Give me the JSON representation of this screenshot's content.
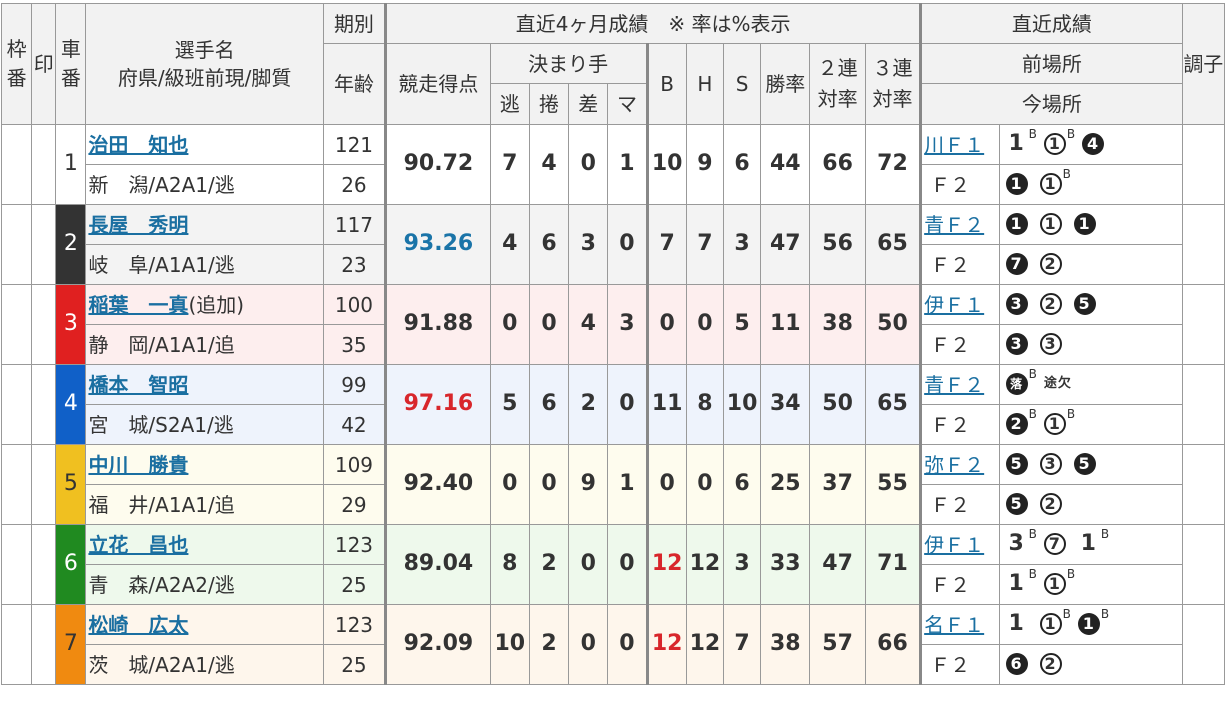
{
  "header": {
    "waku": "枠番",
    "shirushi": "印",
    "sha": "車番",
    "senshu": "選手名",
    "senshu_sub": "府県/級班前現/脚質",
    "kibetsu": "期別",
    "nenrei": "年齢",
    "recent4": "直近4ヶ月成績　※ 率は%表示",
    "score": "競走得点",
    "kimarite": "決まり手",
    "nige": "逃",
    "makuri": "捲",
    "sashi": "差",
    "ma": "マ",
    "b": "B",
    "h": "H",
    "s": "S",
    "win": "勝率",
    "ren2": "２連対率",
    "ren3": "３連対率",
    "recent": "直近成績",
    "prev": "前場所",
    "now": "今場所",
    "choshi": "調子"
  },
  "riders": [
    {
      "num": "1",
      "name": "治田　知也",
      "suffix": "",
      "pref": "新　潟/A2A1/逃",
      "term": "121",
      "age": "26",
      "score": "90.72",
      "score_color": "",
      "nige": "7",
      "makuri": "4",
      "sashi": "0",
      "ma": "1",
      "b": "10",
      "b_color": "",
      "h": "9",
      "s": "6",
      "win": "44",
      "ren2": "66",
      "ren3": "72",
      "venue": "川Ｆ１",
      "venue2": "Ｆ２",
      "bg": "#ffffff",
      "num_bg": "#ffffff",
      "num_fg": "#333333"
    },
    {
      "num": "2",
      "name": "長屋　秀明",
      "suffix": "",
      "pref": "岐　阜/A1A1/逃",
      "term": "117",
      "age": "23",
      "score": "93.26",
      "score_color": "blue",
      "nige": "4",
      "makuri": "6",
      "sashi": "3",
      "ma": "0",
      "b": "7",
      "b_color": "",
      "h": "7",
      "s": "3",
      "win": "47",
      "ren2": "56",
      "ren3": "65",
      "venue": "青Ｆ２",
      "venue2": "Ｆ２",
      "bg": "#f3f3f3",
      "num_bg": "#333333",
      "num_fg": "#ffffff"
    },
    {
      "num": "3",
      "name": "稲葉　一真",
      "suffix": "(追加)",
      "pref": "静　岡/A1A1/追",
      "term": "100",
      "age": "35",
      "score": "91.88",
      "score_color": "",
      "nige": "0",
      "makuri": "0",
      "sashi": "4",
      "ma": "3",
      "b": "0",
      "b_color": "",
      "h": "0",
      "s": "5",
      "win": "11",
      "ren2": "38",
      "ren3": "50",
      "venue": "伊Ｆ１",
      "venue2": "Ｆ２",
      "bg": "#fdeeee",
      "num_bg": "#e02020",
      "num_fg": "#ffffff"
    },
    {
      "num": "4",
      "name": "橋本　智昭",
      "suffix": "",
      "pref": "宮　城/S2A1/逃",
      "term": "99",
      "age": "42",
      "score": "97.16",
      "score_color": "red",
      "nige": "5",
      "makuri": "6",
      "sashi": "2",
      "ma": "0",
      "b": "11",
      "b_color": "",
      "h": "8",
      "s": "10",
      "win": "34",
      "ren2": "50",
      "ren3": "65",
      "venue": "青Ｆ２",
      "venue2": "Ｆ２",
      "bg": "#eef3fc",
      "num_bg": "#1060c8",
      "num_fg": "#ffffff"
    },
    {
      "num": "5",
      "name": "中川　勝貴",
      "suffix": "",
      "pref": "福　井/A1A1/追",
      "term": "109",
      "age": "29",
      "score": "92.40",
      "score_color": "",
      "nige": "0",
      "makuri": "0",
      "sashi": "9",
      "ma": "1",
      "b": "0",
      "b_color": "",
      "h": "0",
      "s": "6",
      "win": "25",
      "ren2": "37",
      "ren3": "55",
      "venue": "弥Ｆ２",
      "venue2": "Ｆ２",
      "bg": "#fefcee",
      "num_bg": "#f0c020",
      "num_fg": "#333333"
    },
    {
      "num": "6",
      "name": "立花　昌也",
      "suffix": "",
      "pref": "青　森/A2A2/逃",
      "term": "123",
      "age": "25",
      "score": "89.04",
      "score_color": "",
      "nige": "8",
      "makuri": "2",
      "sashi": "0",
      "ma": "0",
      "b": "12",
      "b_color": "red",
      "h": "12",
      "s": "3",
      "win": "33",
      "ren2": "47",
      "ren3": "71",
      "venue": "伊Ｆ１",
      "venue2": "Ｆ２",
      "bg": "#eef9ec",
      "num_bg": "#208a20",
      "num_fg": "#ffffff"
    },
    {
      "num": "7",
      "name": "松崎　広太",
      "suffix": "",
      "pref": "茨　城/A2A1/逃",
      "term": "123",
      "age": "25",
      "score": "92.09",
      "score_color": "",
      "nige": "10",
      "makuri": "2",
      "sashi": "0",
      "ma": "0",
      "b": "12",
      "b_color": "red",
      "h": "12",
      "s": "7",
      "win": "38",
      "ren2": "57",
      "ren3": "66",
      "venue": "名Ｆ１",
      "venue2": "Ｆ２",
      "bg": "#fef6ec",
      "num_bg": "#f08a10",
      "num_fg": "#333333"
    }
  ],
  "results": {
    "r1_prev": [
      "1",
      "B",
      "①",
      "B",
      "4"
    ],
    "r1_now": [
      "1",
      "①",
      "B"
    ],
    "r2_prev": [
      "1",
      "①",
      "1"
    ],
    "r2_now": [
      "7",
      "②"
    ],
    "r3_prev": [
      "3",
      "②",
      "5"
    ],
    "r3_now": [
      "3",
      "③"
    ],
    "r4_prev": [
      "落",
      "B",
      "途欠"
    ],
    "r4_now": [
      "2",
      "B",
      "①",
      "B"
    ],
    "r5_prev": [
      "5",
      "③",
      "5"
    ],
    "r5_now": [
      "5",
      "②"
    ],
    "r6_prev": [
      "3",
      "B",
      "⑦",
      "1",
      "B"
    ],
    "r6_now": [
      "1",
      "B",
      "①",
      "B"
    ],
    "r7_prev": [
      "1",
      "①",
      "B",
      "1",
      "B"
    ],
    "r7_now": [
      "6",
      "②"
    ]
  }
}
